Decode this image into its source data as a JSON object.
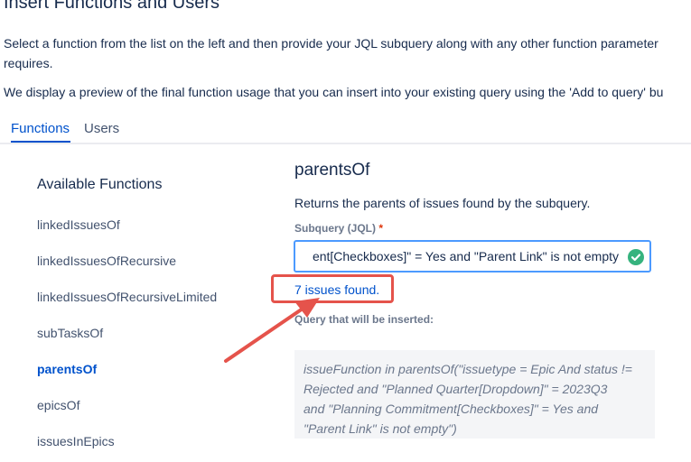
{
  "page": {
    "title": "Insert Functions and Users",
    "intro_line1": "Select a function from the list on the left and then provide your JQL subquery along with any other function parameter",
    "intro_line2": "requires.",
    "intro_line3": "We display a preview of the final function usage that you can insert into your existing query using the 'Add to query' bu"
  },
  "tabs": [
    {
      "label": "Functions",
      "active": true
    },
    {
      "label": "Users",
      "active": false
    }
  ],
  "sidebar": {
    "title": "Available Functions",
    "items": [
      {
        "label": "linkedIssuesOf"
      },
      {
        "label": "linkedIssuesOfRecursive"
      },
      {
        "label": "linkedIssuesOfRecursiveLimited"
      },
      {
        "label": "subTasksOf"
      },
      {
        "label": "parentsOf",
        "selected": true
      },
      {
        "label": "epicsOf"
      },
      {
        "label": "issuesInEpics"
      }
    ]
  },
  "main": {
    "function_name": "parentsOf",
    "description": "Returns the parents of issues found by the subquery.",
    "subquery_label": "Subquery (JQL)",
    "required_marker": "*",
    "subquery_value": "ent[Checkboxes]\" = Yes and \"Parent Link\" is not empty",
    "issues_found": "7 issues found.",
    "query_label": "Query that will be inserted:",
    "preview_lines": [
      "issueFunction in parentsOf(\"issuetype = Epic And status !=",
      "Rejected and \"Planned Quarter[Dropdown]\" = 2023Q3",
      "and \"Planning Commitment[Checkboxes]\" = Yes and",
      "\"Parent Link\" is not empty\")"
    ]
  },
  "colors": {
    "accent": "#0052cc",
    "annotation": "#e5534b",
    "valid": "#36b37e"
  },
  "icons": {
    "valid": "check-circle-icon",
    "annotation": "arrow-icon"
  }
}
